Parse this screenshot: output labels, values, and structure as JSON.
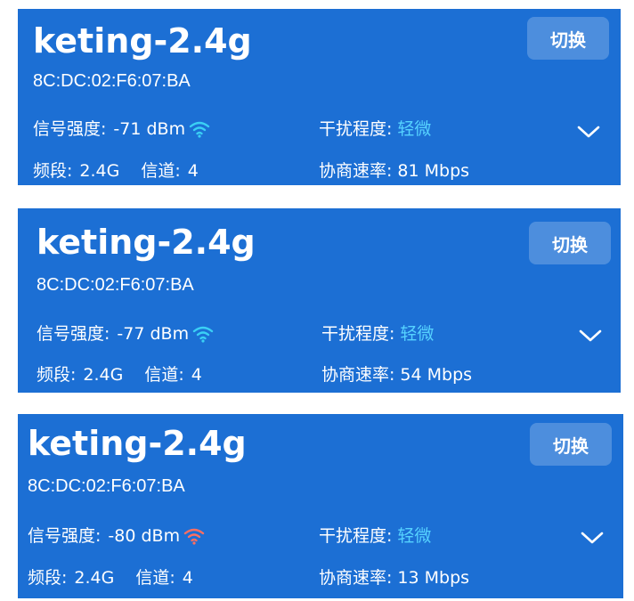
{
  "cards": [
    {
      "ssid": "keting-2.4g",
      "mac": "8C:DC:02:F6:07:BA",
      "switch_label": "切换",
      "signal_label": "信号强度:",
      "signal_value": "-71 dBm",
      "signal_icon": "wifi-icon",
      "signal_icon_color": "#3ad0f5",
      "interference_label": "干扰程度:",
      "interference_value": "轻微",
      "band_label": "频段:",
      "band_value": "2.4G",
      "channel_label": "信道:",
      "channel_value": "4",
      "rate_label": "协商速率:",
      "rate_value": "81 Mbps"
    },
    {
      "ssid": "keting-2.4g",
      "mac": "8C:DC:02:F6:07:BA",
      "switch_label": "切换",
      "signal_label": "信号强度:",
      "signal_value": "-77 dBm",
      "signal_icon": "wifi-icon",
      "signal_icon_color": "#3ad0f5",
      "interference_label": "干扰程度:",
      "interference_value": "轻微",
      "band_label": "频段:",
      "band_value": "2.4G",
      "channel_label": "信道:",
      "channel_value": "4",
      "rate_label": "协商速率:",
      "rate_value": "54 Mbps"
    },
    {
      "ssid": "keting-2.4g",
      "mac": "8C:DC:02:F6:07:BA",
      "switch_label": "切换",
      "signal_label": "信号强度:",
      "signal_value": "-80 dBm",
      "signal_icon": "wifi-icon",
      "signal_icon_color": "#ff6f61",
      "interference_label": "干扰程度:",
      "interference_value": "轻微",
      "band_label": "频段:",
      "band_value": "2.4G",
      "channel_label": "信道:",
      "channel_value": "4",
      "rate_label": "协商速率:",
      "rate_value": "13 Mbps"
    }
  ],
  "colors": {
    "card_background": "#1c6fd4",
    "accent_text": "#56d3ff"
  }
}
